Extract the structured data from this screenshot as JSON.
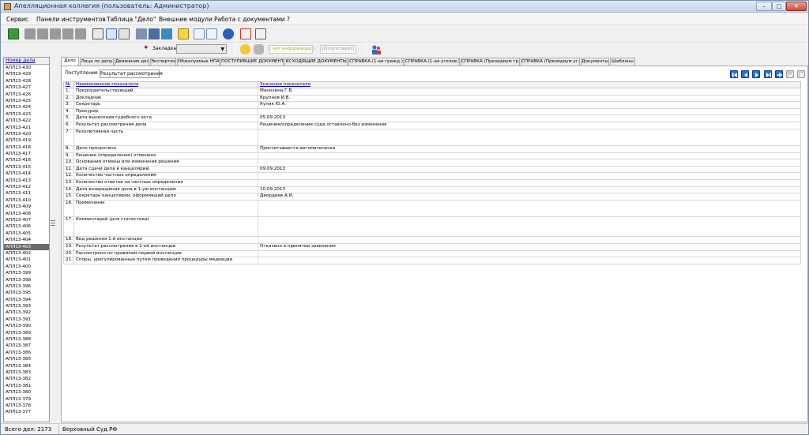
{
  "window": {
    "title": "Апелляционная коллегия (пользователь: Администратор)"
  },
  "menu": [
    "Сервис",
    "Панели инструментов",
    "Таблица \"Дело\"",
    "Внешние модули",
    "Работа с документами",
    "?"
  ],
  "toolbar2": {
    "bookmark_label": "Закладка",
    "bookmark_value": "",
    "no_info": "[ нет информации ]",
    "absent": "[Отсутствует]"
  },
  "cases": {
    "header": "Номер дела",
    "items": [
      "АПЛ13-430",
      "АПЛ13-429",
      "АПЛ13-428",
      "АПЛ13-427",
      "АПЛ13-426",
      "АПЛ13-425",
      "АПЛ13-424",
      "АПЛ13-423",
      "АПЛ13-422",
      "АПЛ13-421",
      "АПЛ13-420",
      "АПЛ13-419",
      "АПЛ13-418",
      "АПЛ13-417",
      "АПЛ13-416",
      "АПЛ13-415",
      "АПЛ13-414",
      "АПЛ13-413",
      "АПЛ13-412",
      "АПЛ13-411",
      "АПЛ13-410",
      "АПЛ13-409",
      "АПЛ13-408",
      "АПЛ13-407",
      "АПЛ13-406",
      "АПЛ13-405",
      "АПЛ13-404",
      "АПЛ13-403",
      "АПЛ13-402",
      "АПЛ13-401",
      "АПЛ13-400",
      "АПЛ13-399",
      "АПЛ13-398",
      "АПЛ13-396",
      "АПЛ13-395",
      "АПЛ13-394",
      "АПЛ13-393",
      "АПЛ13-392",
      "АПЛ13-391",
      "АПЛ13-390",
      "АПЛ13-389",
      "АПЛ13-388",
      "АПЛ13-387",
      "АПЛ13-386",
      "АПЛ13-385",
      "АПЛ13-384",
      "АПЛ13-383",
      "АПЛ13-382",
      "АПЛ13-381",
      "АПЛ13-380",
      "АПЛ13-379",
      "АПЛ13-378",
      "АПЛ13-377"
    ],
    "selected": "АПЛ13-403"
  },
  "tabs": [
    "Дело",
    "Лица по делу",
    "Движение дела",
    "Экспертиза",
    "Обжалуемые НПА",
    "ПОСТУПИВШИЕ ДОКУМЕНТЫ",
    "ИСХОДЯЩИЕ ДОКУМЕНТЫ",
    "СПРАВКА (1-ая гражд.)",
    "СПРАВКА (1-ая уголов.)",
    "СПРАВКА (Президиум гр.)",
    "СПРАВКА (Президиум уг.)",
    "Документы",
    "Шаблоны"
  ],
  "active_tab": "Дело",
  "subtabs": [
    "Поступление",
    "Результат рассмотрения"
  ],
  "grid": {
    "columns": [
      "№",
      "Наименование показателя",
      "Значение показателя"
    ],
    "rows": [
      {
        "num": "1.",
        "name": "Председательствующий",
        "value": "Манохина Г.В."
      },
      {
        "num": "2.",
        "name": "Докладчик",
        "value": "Крупнов И.В."
      },
      {
        "num": "3.",
        "name": "Секретарь",
        "value": "Кулик Ю.А."
      },
      {
        "num": "4.",
        "name": "Прокурор",
        "value": ""
      },
      {
        "num": "5.",
        "name": "Дата вынесения судебного акта",
        "value": "05.09.2013"
      },
      {
        "num": "6.",
        "name": "Результат рассмотрения дела",
        "value": "Решение/определение суда оставлено без изменения"
      },
      {
        "num": "7.",
        "name": "Резолютивная часть",
        "value": ""
      },
      {
        "num": "8.",
        "name": "Дело просрочено",
        "value": "Просчитывается автоматически"
      },
      {
        "num": "9.",
        "name": "Решение (определение) отменено",
        "value": ""
      },
      {
        "num": "10.",
        "name": "Основания отмены или изменения решения",
        "value": ""
      },
      {
        "num": "11.",
        "name": "Дата сдачи дела в канцелярию",
        "value": "09.09.2013"
      },
      {
        "num": "12.",
        "name": "Количество частных определений",
        "value": ""
      },
      {
        "num": "13.",
        "name": "Количество ответов на частные определения",
        "value": ""
      },
      {
        "num": "14.",
        "name": "Дата возвращения дела в 1-ую инстанцию",
        "value": "10.09.2013"
      },
      {
        "num": "15.",
        "name": "Секретарь канцелярии, оформивший дело",
        "value": "Диордиев А.И."
      },
      {
        "num": "16.",
        "name": "Примечание",
        "value": ""
      },
      {
        "num": "17.",
        "name": "Комментарий (для статистики)",
        "value": ""
      },
      {
        "num": "18.",
        "name": "Вид решения 1-й инстанции",
        "value": ""
      },
      {
        "num": "19.",
        "name": "Результат рассмотрения в 1-ой инстанции",
        "value": "Отказано в принятии заявления"
      },
      {
        "num": "20.",
        "name": "Рассмотрено по правилам первой инстанции",
        "value": ""
      },
      {
        "num": "21.",
        "name": "Споры,  урегулированные путем проведения процедуры медиации",
        "value": ""
      }
    ]
  },
  "status": {
    "total": "Всего дел: 2173",
    "court": "Верховный Суд РФ"
  }
}
